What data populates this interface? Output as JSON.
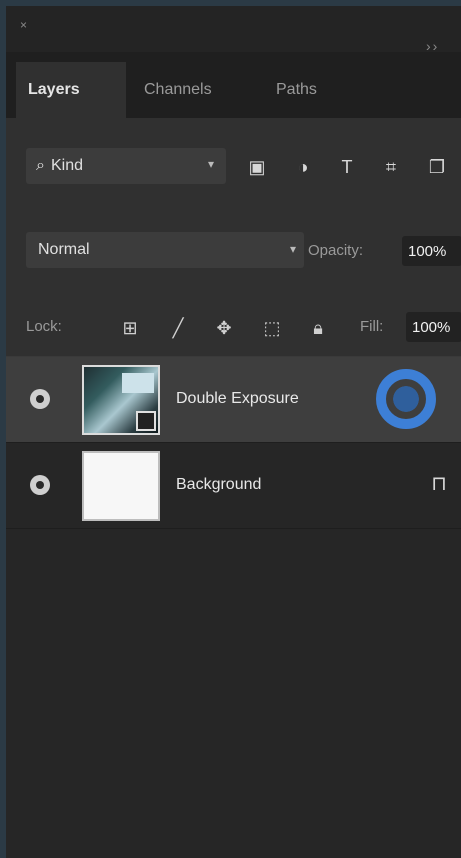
{
  "panel": {
    "tabs": [
      {
        "label": "Layers",
        "active": true
      },
      {
        "label": "Channels",
        "active": false
      },
      {
        "label": "Paths",
        "active": false
      }
    ],
    "menu_icon": "panel-menu-icon"
  },
  "filter": {
    "kind_label": "Kind",
    "search_icon": "search-icon",
    "icons": [
      "pixel-layer-filter-icon",
      "adjustment-layer-filter-icon",
      "type-layer-filter-icon",
      "shape-layer-filter-icon",
      "smart-object-filter-icon"
    ]
  },
  "blend": {
    "mode": "Normal",
    "opacity_label": "Opacity:",
    "opacity_value": "100%"
  },
  "lock": {
    "label": "Lock:",
    "icons": [
      "lock-transparent-pixels-icon",
      "lock-image-pixels-icon",
      "lock-position-icon",
      "lock-artboard-icon",
      "lock-all-icon"
    ],
    "fill_label": "Fill:",
    "fill_value": "100%"
  },
  "layers": [
    {
      "name": "Double Exposure",
      "selected": true,
      "visible": true,
      "type": "smart-object"
    },
    {
      "name": "Background",
      "selected": false,
      "visible": true,
      "type": "locked-background"
    }
  ],
  "colors": {
    "panel_bg": "#303030",
    "list_bg": "#262626",
    "selected_row": "#3e3e3e",
    "accent_cursor": "#3d7fd6"
  }
}
